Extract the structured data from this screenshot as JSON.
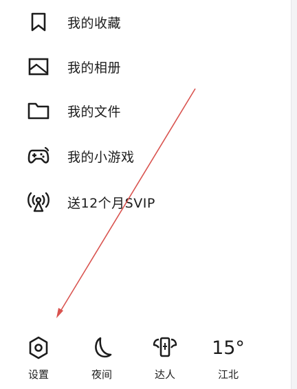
{
  "menu": {
    "items": [
      {
        "label": "我的收藏",
        "icon": "bookmark-icon"
      },
      {
        "label": "我的相册",
        "icon": "picture-icon"
      },
      {
        "label": "我的文件",
        "icon": "folder-icon"
      },
      {
        "label": "我的小游戏",
        "icon": "gamepad-icon"
      },
      {
        "label": "送12个月SVIP",
        "icon": "broadcast-tower-icon"
      }
    ]
  },
  "bottom_bar": {
    "settings": {
      "label": "设置",
      "icon": "gear-hexagon-icon"
    },
    "night": {
      "label": "夜间",
      "icon": "moon-icon"
    },
    "expert": {
      "label": "达人",
      "icon": "winged-phone-icon"
    },
    "weather": {
      "temperature": "15°",
      "label": "江北"
    }
  },
  "annotation": {
    "arrow_color": "#d9534f"
  }
}
